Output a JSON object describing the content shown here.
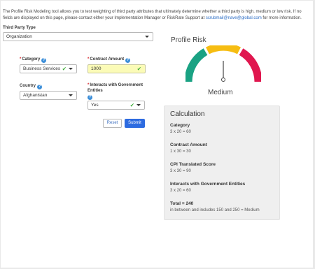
{
  "intro": {
    "text_before": "The Profile Risk Modeling tool allows you to test weighting of third party attributes that ultimately determine whether a third party is high, medium or low risk. If no fields are displayed on this page, please contact either your Implementation Manager or RiskRate Support at ",
    "email": "scrubmail@nave@global.com",
    "text_after": " for more information."
  },
  "third_party_type": {
    "label": "Third Party Type",
    "value": "Organization"
  },
  "fields": {
    "category": {
      "required_mark": "*",
      "label": "Category",
      "value": "Business Services"
    },
    "contract_amount": {
      "required_mark": "*",
      "label": "Contract Amount",
      "value": "1000"
    },
    "country": {
      "label": "Country",
      "value": "Afghanistan"
    },
    "interacts": {
      "required_mark": "*",
      "label": "Interacts with Government Entities",
      "value": "Yes"
    }
  },
  "buttons": {
    "reset": "Reset",
    "submit": "Submit"
  },
  "profile_risk": {
    "title": "Profile Risk",
    "level": "Medium",
    "gauge_colors": {
      "low": "#1aa283",
      "medium": "#f6bd12",
      "high": "#e0174f"
    }
  },
  "calculation": {
    "title": "Calculation",
    "items": [
      {
        "heading": "Category",
        "value": "3 x 20 = 60"
      },
      {
        "heading": "Contract Amount",
        "value": "1 x 30 = 30"
      },
      {
        "heading": "CPI Translated Score",
        "value": "3 x 30 = 90"
      },
      {
        "heading": "Interacts with Government Entities",
        "value": "3 x 20 = 60"
      }
    ],
    "total": {
      "heading": "Total = 240",
      "value": "in between and includes 150 and 250 = Medium"
    }
  }
}
